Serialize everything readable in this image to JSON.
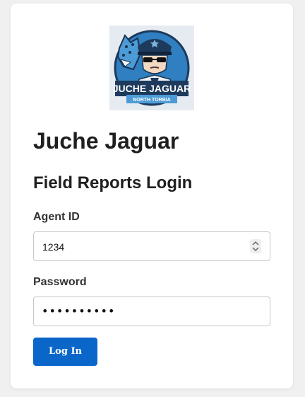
{
  "app": {
    "title": "Juche Jaguar",
    "logo": {
      "name_text": "JUCHE JAGUAR",
      "subtitle_text": "NORTH TORBIA"
    }
  },
  "form": {
    "heading": "Field Reports Login",
    "agent_id": {
      "label": "Agent ID",
      "value": "1234"
    },
    "password": {
      "label": "Password",
      "masked_value": "••••••••••"
    },
    "submit_label": "Log In"
  },
  "colors": {
    "accent": "#0a66c9",
    "logo_background": "#2f7fc1",
    "logo_banner": "#1d3a5c"
  }
}
